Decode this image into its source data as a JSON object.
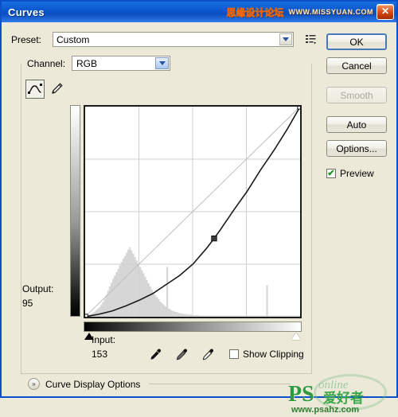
{
  "window": {
    "title": "Curves",
    "close_label": "✕",
    "watermark_cn": "思缘设计论坛",
    "watermark_url": "WWW.MISSYUAN.COM"
  },
  "preset": {
    "label": "Preset:",
    "value": "Custom",
    "menu_icon": "preset-list-icon",
    "dropdown_icon": "chevron-down-icon"
  },
  "channel": {
    "label": "Channel:",
    "value": "RGB",
    "dropdown_icon": "chevron-down-icon"
  },
  "tools": {
    "curve_icon": "curve-edit-icon",
    "pencil_icon": "pencil-icon"
  },
  "readouts": {
    "output_label": "Output:",
    "output_value": "95",
    "input_label": "Input:",
    "input_value": "153"
  },
  "droppers": [
    {
      "name": "black-point-eyedropper"
    },
    {
      "name": "gray-point-eyedropper"
    },
    {
      "name": "white-point-eyedropper"
    }
  ],
  "show_clipping": {
    "label": "Show Clipping",
    "checked": false
  },
  "preview": {
    "label": "Preview",
    "checked": true,
    "check_glyph": "✔"
  },
  "curve_display_options": {
    "label": "Curve Display Options",
    "toggle_glyph": "»"
  },
  "buttons": {
    "ok": "OK",
    "cancel": "Cancel",
    "smooth": "Smooth",
    "auto": "Auto",
    "options": "Options..."
  },
  "footer_watermark": {
    "ps": "PS",
    "cn": "爱好者",
    "site": "www.psahz.com",
    "ghost": "online"
  },
  "chart_data": {
    "type": "line",
    "title": "Curves tone curve",
    "xlabel": "Input",
    "ylabel": "Output",
    "xlim": [
      0,
      255
    ],
    "ylim": [
      0,
      255
    ],
    "grid": true,
    "grid_divisions": 4,
    "series": [
      {
        "name": "diagonal-baseline",
        "color": "#bfbfbf",
        "points": [
          [
            0,
            0
          ],
          [
            255,
            255
          ]
        ]
      },
      {
        "name": "tone-curve",
        "color": "#1a1a1a",
        "control_points": [
          [
            0,
            0
          ],
          [
            153,
            95
          ],
          [
            255,
            255
          ]
        ],
        "points": [
          [
            0,
            0
          ],
          [
            16,
            3
          ],
          [
            32,
            7
          ],
          [
            48,
            13
          ],
          [
            64,
            20
          ],
          [
            80,
            28
          ],
          [
            96,
            39
          ],
          [
            112,
            50
          ],
          [
            128,
            64
          ],
          [
            144,
            83
          ],
          [
            153,
            95
          ],
          [
            160,
            105
          ],
          [
            176,
            129
          ],
          [
            192,
            152
          ],
          [
            208,
            178
          ],
          [
            224,
            202
          ],
          [
            240,
            228
          ],
          [
            255,
            255
          ]
        ]
      }
    ],
    "histogram": {
      "name": "image-histogram",
      "color": "#d6d6d6",
      "bins": [
        2,
        3,
        4,
        5,
        7,
        9,
        12,
        15,
        18,
        22,
        27,
        33,
        40,
        48,
        56,
        63,
        70,
        76,
        82,
        88,
        95,
        101,
        107,
        112,
        118,
        124,
        128,
        122,
        116,
        110,
        104,
        98,
        92,
        86,
        80,
        74,
        68,
        62,
        56,
        50,
        45,
        40,
        36,
        32,
        28,
        25,
        22,
        19,
        17,
        15,
        13,
        11,
        10,
        9,
        8,
        7,
        6,
        6,
        5,
        5,
        4,
        4,
        4,
        3,
        3,
        3,
        3,
        2,
        2,
        2,
        2,
        2,
        2,
        2,
        2,
        2,
        2,
        2,
        2,
        2,
        2,
        2,
        2,
        2,
        2,
        2,
        2,
        2,
        2,
        2,
        2,
        2,
        2,
        2,
        2,
        2,
        2,
        2,
        2,
        2,
        2,
        2,
        2,
        2,
        2,
        2,
        2,
        2,
        2,
        2,
        2,
        2,
        2,
        2,
        2,
        2,
        2,
        2,
        2,
        2,
        2,
        2,
        2,
        2,
        2,
        2,
        2
      ],
      "spikes": [
        {
          "bin": 107,
          "height": 58
        },
        {
          "bin": 48,
          "height": 92
        }
      ]
    },
    "markers": {
      "selected_point": {
        "input": 153,
        "output": 95
      },
      "endpoints": [
        {
          "input": 0,
          "output": 0
        },
        {
          "input": 255,
          "output": 255
        }
      ]
    },
    "sliders": {
      "black_point": 0,
      "white_point": 255
    }
  }
}
